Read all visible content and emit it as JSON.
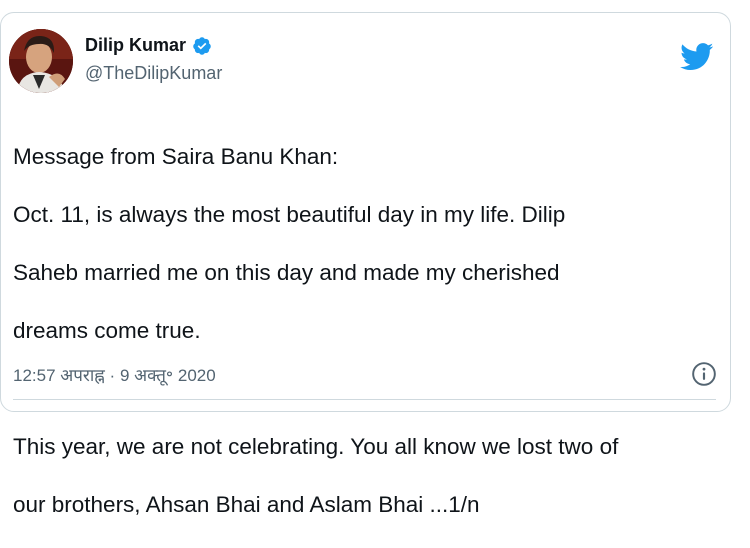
{
  "tweet": {
    "author": {
      "display_name": "Dilip Kumar",
      "handle": "@TheDilipKumar",
      "verified": true,
      "avatar_icon": "profile-photo"
    },
    "text_lines": [
      "Message from Saira Banu Khan:",
      "Oct. 11, is always the most beautiful day in my life. Dilip",
      "Saheb married me on this day and made my cherished",
      "dreams come true.",
      "",
      "This year, we are not celebrating. You all know we lost two of",
      "our brothers, Ahsan Bhai and Aslam Bhai ...1/n"
    ],
    "timestamp": "12:57 अपराह्न · 9 अक्तू॰ 2020",
    "icons": {
      "brand": "twitter-bird-icon",
      "info": "info-icon",
      "verified": "verified-badge-icon"
    },
    "colors": {
      "twitter_blue": "#1d9bf0",
      "text": "#0f1419",
      "secondary": "#536471",
      "border": "#cfd9de"
    }
  }
}
